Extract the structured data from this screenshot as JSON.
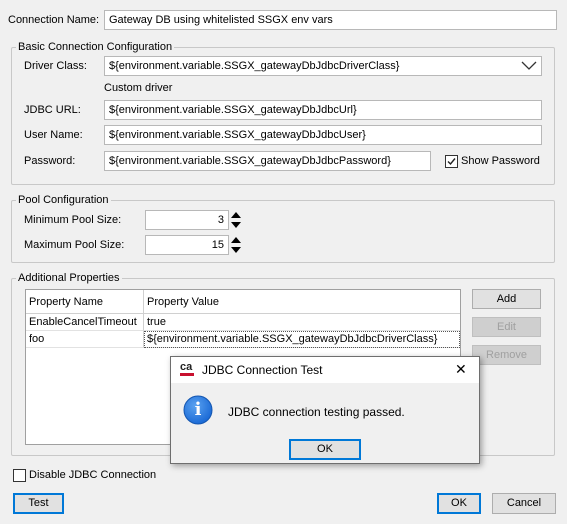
{
  "connection": {
    "name_label": "Connection Name:",
    "name_value": "Gateway DB using whitelisted SSGX env vars"
  },
  "basic": {
    "title": "Basic Connection Configuration",
    "driver_label": "Driver Class:",
    "driver_value": "${environment.variable.SSGX_gatewayDbJdbcDriverClass}",
    "custom_driver": "Custom driver",
    "url_label": "JDBC URL:",
    "url_value": "${environment.variable.SSGX_gatewayDbJdbcUrl}",
    "user_label": "User Name:",
    "user_value": "${environment.variable.SSGX_gatewayDbJdbcUser}",
    "password_label": "Password:",
    "password_value": "${environment.variable.SSGX_gatewayDbJdbcPassword}",
    "show_password_label": "Show Password",
    "show_password_checked": true
  },
  "pool": {
    "title": "Pool Configuration",
    "min_label": "Minimum Pool Size:",
    "min_value": "3",
    "max_label": "Maximum Pool Size:",
    "max_value": "15"
  },
  "additional": {
    "title": "Additional Properties",
    "columns": [
      "Property Name",
      "Property Value"
    ],
    "rows": [
      {
        "name": "EnableCancelTimeout",
        "value": "true"
      },
      {
        "name": "foo",
        "value": "${environment.variable.SSGX_gatewayDbJdbcDriverClass}"
      }
    ],
    "add_label": "Add",
    "edit_label": "Edit",
    "remove_label": "Remove"
  },
  "disable_label": "Disable JDBC Connection",
  "disable_checked": false,
  "footer": {
    "test_label": "Test",
    "ok_label": "OK",
    "cancel_label": "Cancel"
  },
  "dialog": {
    "logo_text": "ca",
    "title": "JDBC Connection Test",
    "message": "JDBC connection testing passed.",
    "ok_label": "OK",
    "close_glyph": "✕",
    "info_glyph": "i"
  },
  "colors": {
    "background": "#f0f0f0",
    "info_blue": "#1b6ad6",
    "focus_blue": "#0078d7",
    "logo_red": "#c8102e"
  }
}
